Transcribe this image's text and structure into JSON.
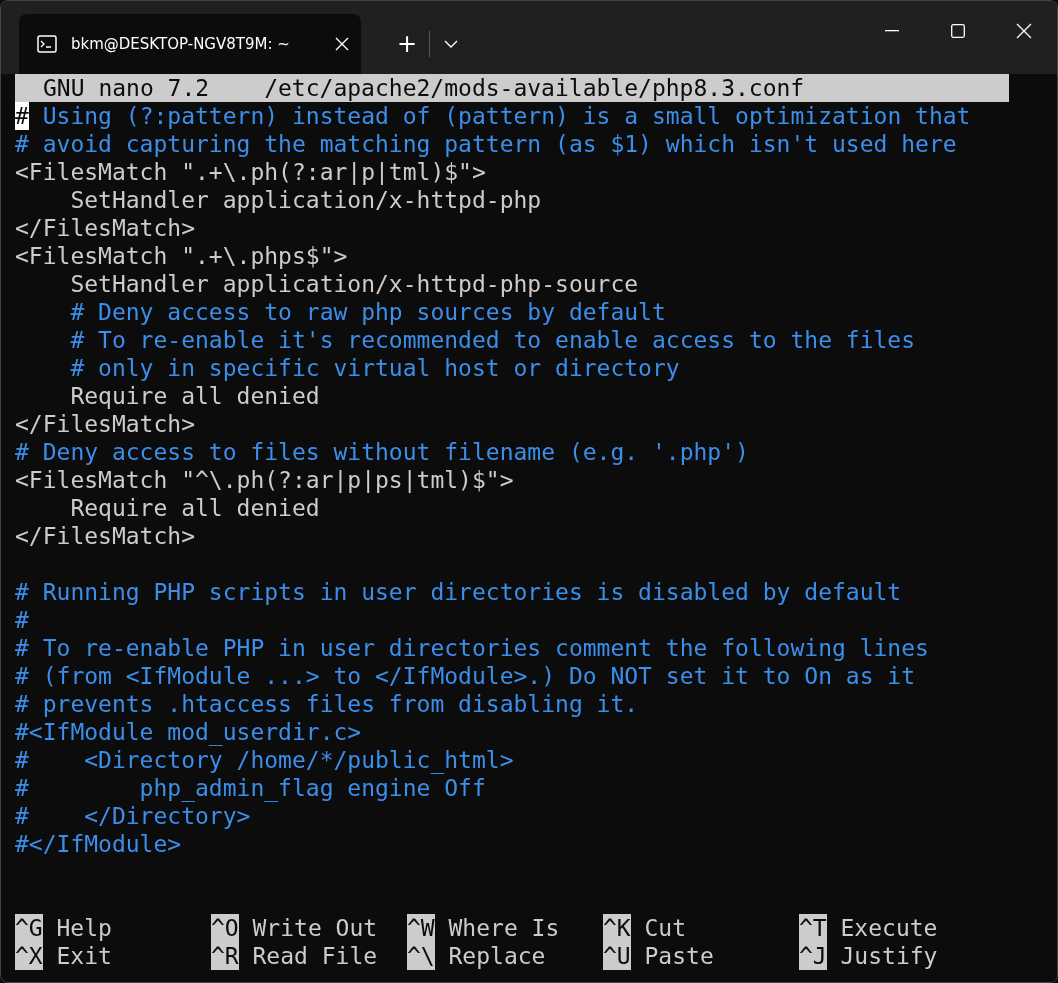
{
  "window": {
    "tab_title": "bkm@DESKTOP-NGV8T9M: ~",
    "new_tab": "+"
  },
  "nano": {
    "version": "GNU nano 7.2",
    "file": "/etc/apache2/mods-available/php8.3.conf",
    "lines": [
      {
        "kind": "comment",
        "text": "# Using (?:pattern) instead of (pattern) is a small optimization that",
        "cursor": true
      },
      {
        "kind": "comment",
        "text": "# avoid capturing the matching pattern (as $1) which isn't used here",
        "cursor": false
      },
      {
        "kind": "code",
        "text": "<FilesMatch \".+\\.ph(?:ar|p|tml)$\">",
        "cursor": false
      },
      {
        "kind": "code",
        "text": "    SetHandler application/x-httpd-php",
        "cursor": false
      },
      {
        "kind": "code",
        "text": "</FilesMatch>",
        "cursor": false
      },
      {
        "kind": "code",
        "text": "<FilesMatch \".+\\.phps$\">",
        "cursor": false
      },
      {
        "kind": "code",
        "text": "    SetHandler application/x-httpd-php-source",
        "cursor": false
      },
      {
        "kind": "comment",
        "text": "    # Deny access to raw php sources by default",
        "cursor": false
      },
      {
        "kind": "comment",
        "text": "    # To re-enable it's recommended to enable access to the files",
        "cursor": false
      },
      {
        "kind": "comment",
        "text": "    # only in specific virtual host or directory",
        "cursor": false
      },
      {
        "kind": "code",
        "text": "    Require all denied",
        "cursor": false
      },
      {
        "kind": "code",
        "text": "</FilesMatch>",
        "cursor": false
      },
      {
        "kind": "comment",
        "text": "# Deny access to files without filename (e.g. '.php')",
        "cursor": false
      },
      {
        "kind": "code",
        "text": "<FilesMatch \"^\\.ph(?:ar|p|ps|tml)$\">",
        "cursor": false
      },
      {
        "kind": "code",
        "text": "    Require all denied",
        "cursor": false
      },
      {
        "kind": "code",
        "text": "</FilesMatch>",
        "cursor": false
      },
      {
        "kind": "blank",
        "cursor": false
      },
      {
        "kind": "comment",
        "text": "# Running PHP scripts in user directories is disabled by default",
        "cursor": false
      },
      {
        "kind": "comment",
        "text": "#",
        "cursor": false
      },
      {
        "kind": "comment",
        "text": "# To re-enable PHP in user directories comment the following lines",
        "cursor": false
      },
      {
        "kind": "comment",
        "text": "# (from <IfModule ...> to </IfModule>.) Do NOT set it to On as it",
        "cursor": false
      },
      {
        "kind": "comment",
        "text": "# prevents .htaccess files from disabling it.",
        "cursor": false
      },
      {
        "kind": "comment",
        "text": "#<IfModule mod_userdir.c>",
        "cursor": false
      },
      {
        "kind": "comment",
        "text": "#    <Directory /home/*/public_html>",
        "cursor": false
      },
      {
        "kind": "comment",
        "text": "#        php_admin_flag engine Off",
        "cursor": false
      },
      {
        "kind": "comment",
        "text": "#    </Directory>",
        "cursor": false
      },
      {
        "kind": "comment",
        "text": "#</IfModule>",
        "cursor": false
      }
    ],
    "shortcuts": [
      {
        "key": "^G",
        "label": "Help"
      },
      {
        "key": "^O",
        "label": "Write Out"
      },
      {
        "key": "^W",
        "label": "Where Is"
      },
      {
        "key": "^K",
        "label": "Cut"
      },
      {
        "key": "^T",
        "label": "Execute"
      },
      {
        "key": "^X",
        "label": "Exit"
      },
      {
        "key": "^R",
        "label": "Read File"
      },
      {
        "key": "^\\",
        "label": "Replace"
      },
      {
        "key": "^U",
        "label": "Paste"
      },
      {
        "key": "^J",
        "label": "Justify"
      }
    ]
  }
}
